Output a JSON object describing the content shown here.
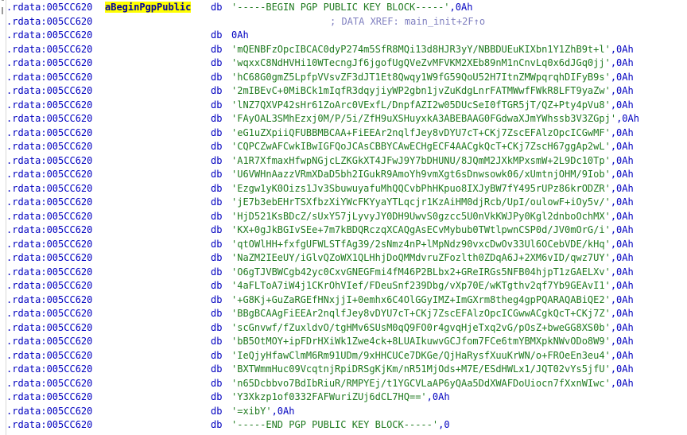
{
  "app": {
    "name": "ida-disassembly-listing",
    "view": "IDA View / hex-rays text listing"
  },
  "colors": {
    "segment_address": "#0000c0",
    "string_literal": "#1f7a1f",
    "mnemonic": "#0000c0",
    "comment": "#8080c0",
    "highlight_background": "#ffff00",
    "highlight_text": "#0000a0",
    "background": "#ffffff"
  },
  "segment_address": ".rdata:005CC620",
  "highlighted_name": "aBeginPgpPublic",
  "mnemonic": "db",
  "xref": {
    "comment_prefix": ";",
    "label": "DATA XREF:",
    "target": "main_init+2F",
    "suffix": "↑o"
  },
  "lines": [
    {
      "name": "aBeginPgpPublic",
      "highlighted": true,
      "mnemonic": "db",
      "string": "-----BEGIN PGP PUBLIC KEY BLOCK-----",
      "trailer": ",0Ah"
    },
    {
      "name": "",
      "mnemonic": "",
      "xref": true
    },
    {
      "name": "",
      "mnemonic": "db",
      "raw": "0Ah"
    },
    {
      "name": "",
      "mnemonic": "db",
      "string": "mQENBFzOpcIBCAC0dyP274m5SfR8MQi13d8HJR3yY/NBBDUEuKIXbn1Y1ZhB9t+l",
      "trailer": ",0Ah"
    },
    {
      "name": "",
      "mnemonic": "db",
      "string": "wqxxC8NdHVHi10WTecngJf6jgofUgQVeZvMFVKM2XEb89nM1nCnvLq0x6dJGq0jj",
      "trailer": ",0Ah"
    },
    {
      "name": "",
      "mnemonic": "db",
      "string": "hC68G0gmZ5LpfpVVsvZF3dJT1Et8Qwqy1W9fG59QoU52H7ItnZMWpqrqhDIFyB9s",
      "trailer": ",0Ah"
    },
    {
      "name": "",
      "mnemonic": "db",
      "string": "2mIBEvC+0MiBCk1mIqfR3dqyjiyWP2gbn1jvZuKdgLnrFATMWwfFWkR8LFT9yaZw",
      "trailer": ",0Ah"
    },
    {
      "name": "",
      "mnemonic": "db",
      "string": "lNZ7QXVP42sHr61ZoArc0VExfL/DnpfAZI2w05DUcSeI0fTGR5jT/QZ+Pty4pVu8",
      "trailer": ",0Ah"
    },
    {
      "name": "",
      "mnemonic": "db",
      "string": "FAyOAL3SMhEzxj0M/P/5i/ZfH9uXSHuyxkA3ABEBAAG0FGdwaXJmYWhssb3V3ZGpj",
      "trailer": ",0Ah"
    },
    {
      "name": "",
      "mnemonic": "db",
      "string": "eG1uZXpiiQFUBBMBCAA+FiEEAr2nqlfJey8vDYU7cT+CKj7ZscEFAlzOpcICGwMF",
      "trailer": ",0Ah"
    },
    {
      "name": "",
      "mnemonic": "db",
      "string": "CQPCZwAFCwkIBwIGFQoJCAsCBBYCAwECHgECF4AACgkQcT+CKj7ZscH67ggAp2wL",
      "trailer": ",0Ah"
    },
    {
      "name": "",
      "mnemonic": "db",
      "string": "A1R7XfmaxHfwpNGjcLZKGkXT4JFwJ9Y7bDHUNU/8JQmM2JXkMPxsmW+2L9Dc10Tp",
      "trailer": ",0Ah"
    },
    {
      "name": "",
      "mnemonic": "db",
      "string": "U6VWHnAazzVRmXDaD5bh2IGukR9AmoYh9vmXgt6sDnwsowk06/xUmtnjOHM/9Iob",
      "trailer": ",0Ah"
    },
    {
      "name": "",
      "mnemonic": "db",
      "string": "Ezgw1yK0Oizs1Jv3SbuwuyafuMhQQCvbPhHKpuo8IXJyBW7fY495rUPz86krODZR",
      "trailer": ",0Ah"
    },
    {
      "name": "",
      "mnemonic": "db",
      "string": "jE7b3ebEHrTSXfbzXiYWcFKYyaYTLqcjr1KzAiHM0djRcb/UpI/oulowF+iOy5v/",
      "trailer": ",0Ah"
    },
    {
      "name": "",
      "mnemonic": "db",
      "string": "HjD521KsBDcZ/sUxY57jLyvyJY0DH9UwvS0gzcc5U0nVkKWJPy0Kgl2dnboOchMX",
      "trailer": ",0Ah"
    },
    {
      "name": "",
      "mnemonic": "db",
      "string": "KX+0gJkBGIvSEe+7m7kBDQRczqXCAQgAsECvMybub0TWtlpwnCSP0d/JV0mOrG/i",
      "trailer": ",0Ah"
    },
    {
      "name": "",
      "mnemonic": "db",
      "string": "qtOWlHH+fxfgUFWLSTfAg39/2sNmz4nP+lMpNdz90vxcDwOv33Ul6OCebVDE/kHq",
      "trailer": ",0Ah"
    },
    {
      "name": "",
      "mnemonic": "db",
      "string": "NaZM2IEeUY/iGlvQZoWX1QLHhjDoQMMdvruZFozlth0ZDqA6J+2XM6vID/qwz7UY",
      "trailer": ",0Ah"
    },
    {
      "name": "",
      "mnemonic": "db",
      "string": "O6gTJVBWCgb42yc0CxvGNEGFmi4fM46P2BLbx2+GReIRGs5NFB04hjpT1zGAELXv",
      "trailer": ",0Ah"
    },
    {
      "name": "",
      "mnemonic": "db",
      "string": "4aFLToA7iW4j1CKrOhVIef/FDeuSnf239Dbg/vXp70E/wKTgthv2qf7Yb9GEAvI1",
      "trailer": ",0Ah"
    },
    {
      "name": "",
      "mnemonic": "db",
      "string": "+G8Kj+GuZaRGEfHNxjjI+0emhx6C4OlGGyIMZ+ImGXrm8theg4gpPQARAQABiQE2",
      "trailer": ",0Ah"
    },
    {
      "name": "",
      "mnemonic": "db",
      "string": "BBgBCAAgFiEEAr2nqlfJey8vDYU7cT+CKj7ZscEFAlzOpcICGwwACgkQcT+CKj7Z",
      "trailer": ",0Ah"
    },
    {
      "name": "",
      "mnemonic": "db",
      "string": "scGnvwf/fZuxldvO/tgHMv6SUsM0qQ9FO0r4gvqHjeTxq2vG/pOsZ+bweGG8XS0b",
      "trailer": ",0Ah"
    },
    {
      "name": "",
      "mnemonic": "db",
      "string": "bB5OtMOY+ipFDrHXiWk1Zwe4ck+8LUAIkuwvGCJfom7FCe6tmYBMXpkNWvODo8W9",
      "trailer": ",0Ah"
    },
    {
      "name": "",
      "mnemonic": "db",
      "string": "IeQjyHfawClmM6Rm91UDm/9xHHCUCe7DKGe/QjHaRysfXuuKrWN/o+FROeEn3eu4",
      "trailer": ",0Ah"
    },
    {
      "name": "",
      "mnemonic": "db",
      "string": "BXTWmmHuc09VcqtnjRpiDRSgKjKm/nR51MjOds+M7E/ESdHWLx1/JQT02vYs5jfU",
      "trailer": ",0Ah"
    },
    {
      "name": "",
      "mnemonic": "db",
      "string": "n65Dcbbvo7BdIbRiuR/RMPYEj/t1YGCVLaAP6yQAa5DdXWAFDoUiocn7fXxnWIwc",
      "trailer": ",0Ah"
    },
    {
      "name": "",
      "mnemonic": "db",
      "string": "Y3Xkzp1of0332FAFWuriZUj6dCL7HQ==",
      "trailer": ",0Ah"
    },
    {
      "name": "",
      "mnemonic": "db",
      "string": "=xibY",
      "trailer": ",0Ah"
    },
    {
      "name": "",
      "mnemonic": "db",
      "string": "-----END PGP PUBLIC KEY BLOCK-----",
      "trailer": ",0"
    }
  ]
}
